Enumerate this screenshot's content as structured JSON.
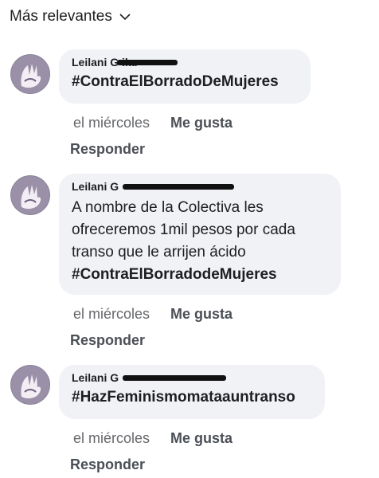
{
  "sort": {
    "label": "Más relevantes"
  },
  "comments": [
    {
      "author": "Leilani G         ilar",
      "lines": [],
      "hashtag": "#ContraElBorradoDeMujeres",
      "time": "el miércoles",
      "like": "Me gusta",
      "reply": "Responder"
    },
    {
      "author": "Leilani G",
      "lines": [
        "A nombre de la Colectiva les",
        "ofreceremos 1mil pesos por cada",
        "transo que le arrijen ácido"
      ],
      "hashtag": "#ContraElBorradodeMujeres",
      "time": "el miércoles",
      "like": "Me gusta",
      "reply": "Responder"
    },
    {
      "author": "Leilani G",
      "lines": [],
      "hashtag": "#HazFeminismomataauntranso",
      "time": "el miércoles",
      "like": "Me gusta",
      "reply": "Responder"
    }
  ]
}
